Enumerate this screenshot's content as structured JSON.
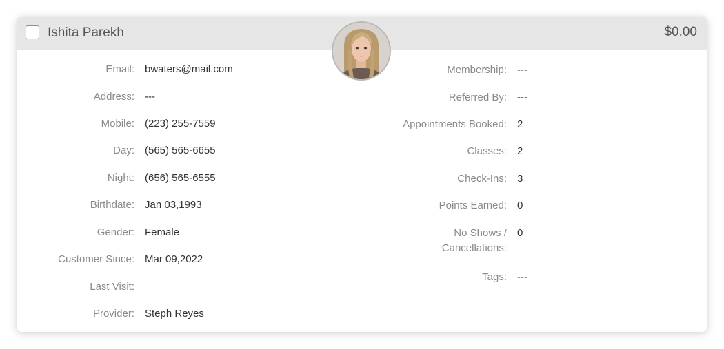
{
  "client": {
    "name": "Ishita Parekh",
    "balance": "$0.00",
    "avatar_icon": "client-photo"
  },
  "details_left": [
    {
      "label": "Email:",
      "value": "bwaters@mail.com"
    },
    {
      "label": "Address:",
      "value": "---"
    },
    {
      "label": "Mobile:",
      "value": "(223) 255-7559"
    },
    {
      "label": "Day:",
      "value": "(565) 565-6655"
    },
    {
      "label": "Night:",
      "value": "(656) 565-6555"
    },
    {
      "label": "Birthdate:",
      "value": "Jan 03,1993"
    },
    {
      "label": "Gender:",
      "value": "Female"
    },
    {
      "label": "Customer Since:",
      "value": "Mar 09,2022"
    },
    {
      "label": "Last Visit:",
      "value": ""
    },
    {
      "label": "Provider:",
      "value": "Steph Reyes"
    }
  ],
  "details_right": [
    {
      "label": "Membership:",
      "value": "---"
    },
    {
      "label": "Referred By:",
      "value": "---"
    },
    {
      "label": "Appointments Booked:",
      "value": "2"
    },
    {
      "label": "Classes:",
      "value": "2"
    },
    {
      "label": "Check-Ins:",
      "value": "3"
    },
    {
      "label": "Points Earned:",
      "value": "0"
    },
    {
      "label": "No Shows / Cancellations:",
      "value": "0"
    },
    {
      "label": "Tags:",
      "value": "---"
    }
  ],
  "colors": {
    "header_bg": "#e6e6e6",
    "label": "#8a8a8a",
    "value": "#333333",
    "title": "#555555"
  }
}
